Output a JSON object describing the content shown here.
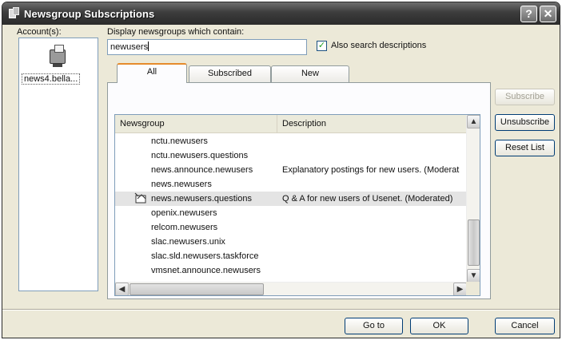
{
  "window": {
    "title": "Newsgroup Subscriptions",
    "help_label": "?",
    "close_label": "✕"
  },
  "accounts": {
    "label": "Account(s):",
    "items": [
      {
        "name": "news4.bella...",
        "icon": "news-server-icon"
      }
    ]
  },
  "filter": {
    "label": "Display newsgroups which contain:",
    "value": "newusers",
    "also_search_label": "Also search descriptions",
    "also_search_checked": true
  },
  "tabs": [
    {
      "label": "All",
      "active": true
    },
    {
      "label": "Subscribed",
      "active": false
    },
    {
      "label": "New",
      "active": false
    }
  ],
  "list": {
    "columns": [
      "Newsgroup",
      "Description"
    ],
    "rows": [
      {
        "newsgroup": "nctu.newusers",
        "description": ""
      },
      {
        "newsgroup": "nctu.newusers.questions",
        "description": ""
      },
      {
        "newsgroup": "news.announce.newusers",
        "description": "Explanatory postings for new users. (Moderat"
      },
      {
        "newsgroup": "news.newusers",
        "description": ""
      },
      {
        "newsgroup": "news.newusers.questions",
        "description": "Q & A for new users of Usenet. (Moderated)",
        "subscribed": true,
        "selected": true
      },
      {
        "newsgroup": "openix.newusers",
        "description": ""
      },
      {
        "newsgroup": "relcom.newusers",
        "description": ""
      },
      {
        "newsgroup": "slac.newusers.unix",
        "description": ""
      },
      {
        "newsgroup": "slac.sld.newusers.taskforce",
        "description": ""
      },
      {
        "newsgroup": "vmsnet.announce.newusers",
        "description": ""
      }
    ]
  },
  "scroll": {
    "up": "▲",
    "down": "▼",
    "left": "◀",
    "right": "▶"
  },
  "side_buttons": {
    "subscribe": "Subscribe",
    "unsubscribe": "Unsubscribe",
    "reset_list": "Reset List"
  },
  "bottom_buttons": {
    "goto": "Go to",
    "ok": "OK",
    "cancel": "Cancel"
  },
  "colors": {
    "dialog_bg": "#ece9d8",
    "title_bar": "#3c3c3c",
    "active_tab_accent": "#e68b2c"
  }
}
